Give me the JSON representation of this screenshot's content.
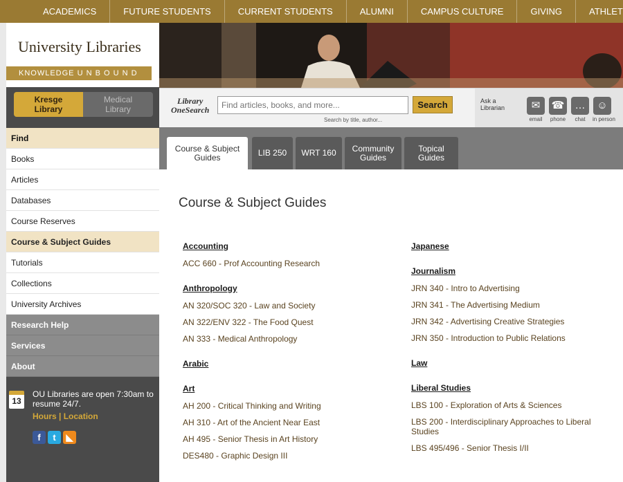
{
  "topnav": [
    "ACADEMICS",
    "FUTURE STUDENTS",
    "CURRENT STUDENTS",
    "ALUMNI",
    "CAMPUS CULTURE",
    "GIVING",
    "ATHLETICS"
  ],
  "logo": {
    "title": "University Libraries",
    "tagline": "KNOWLEDGE U N B O U N D"
  },
  "library_switch": {
    "kresge": "Kresge\nLibrary",
    "medical": "Medical\nLibrary"
  },
  "sidenav": [
    {
      "label": "Find",
      "style": "head"
    },
    {
      "label": "Books",
      "style": ""
    },
    {
      "label": "Articles",
      "style": ""
    },
    {
      "label": "Databases",
      "style": ""
    },
    {
      "label": "Course Reserves",
      "style": ""
    },
    {
      "label": "Course & Subject Guides",
      "style": "active"
    },
    {
      "label": "Tutorials",
      "style": ""
    },
    {
      "label": "Collections",
      "style": ""
    },
    {
      "label": "University Archives",
      "style": ""
    },
    {
      "label": "Research Help",
      "style": "dark"
    },
    {
      "label": "Services",
      "style": "dark"
    },
    {
      "label": "About",
      "style": "dark"
    }
  ],
  "hours": {
    "date": "13",
    "text": "OU Libraries are open 7:30am to resume 24/7.",
    "hours_link": "Hours",
    "separator": "|",
    "location_link": "Location"
  },
  "social": [
    {
      "icon": "facebook-icon",
      "glyph": "f",
      "color": "#3b5998"
    },
    {
      "icon": "twitter-icon",
      "glyph": "t",
      "color": "#29a9e0"
    },
    {
      "icon": "rss-icon",
      "glyph": "◣",
      "color": "#f08a1c"
    }
  ],
  "search": {
    "logo_line1": "Library",
    "logo_line2": "OneSearch",
    "placeholder": "Find articles, books, and more...",
    "hint": "Search by title, author...",
    "button": "Search"
  },
  "ask": {
    "label_line1": "Ask a",
    "label_line2": "Librarian",
    "contacts": [
      {
        "name": "email",
        "glyph": "✉"
      },
      {
        "name": "phone",
        "glyph": "☎"
      },
      {
        "name": "chat",
        "glyph": "…"
      },
      {
        "name": "in person",
        "glyph": "☺"
      }
    ]
  },
  "tabs": [
    {
      "label": "Course & Subject\nGuides",
      "active": true
    },
    {
      "label": "LIB 250",
      "active": false
    },
    {
      "label": "WRT 160",
      "active": false
    },
    {
      "label": "Community\nGuides",
      "active": false
    },
    {
      "label": "Topical\nGuides",
      "active": false
    }
  ],
  "main": {
    "title": "Course & Subject Guides",
    "left_column": [
      {
        "subject": "Accounting",
        "courses": [
          "ACC 660 - Prof Accounting Research"
        ]
      },
      {
        "subject": "Anthropology",
        "courses": [
          "AN 320/SOC 320 - Law and Society",
          "AN 322/ENV 322 - The Food Quest",
          "AN 333 - Medical Anthropology"
        ]
      },
      {
        "subject": "Arabic",
        "courses": []
      },
      {
        "subject": "Art",
        "courses": [
          "AH 200 - Critical Thinking and Writing",
          "AH 310 - Art of the Ancient Near East",
          "AH 495 - Senior Thesis in Art History",
          "DES480 - Graphic Design III"
        ]
      }
    ],
    "right_column": [
      {
        "subject": "Japanese",
        "courses": []
      },
      {
        "subject": "Journalism",
        "courses": [
          "JRN 340 - Intro to Advertising",
          "JRN 341 - The Advertising Medium",
          "JRN 342 - Advertising Creative Strategies",
          "JRN 350 - Introduction to Public Relations"
        ]
      },
      {
        "subject": "Law",
        "courses": []
      },
      {
        "subject": "Liberal Studies",
        "courses": [
          "LBS 100 - Exploration of Arts & Sciences",
          "LBS 200 - Interdisciplinary Approaches to Liberal Studies",
          "LBS 495/496 - Senior Thesis I/II"
        ]
      }
    ]
  }
}
